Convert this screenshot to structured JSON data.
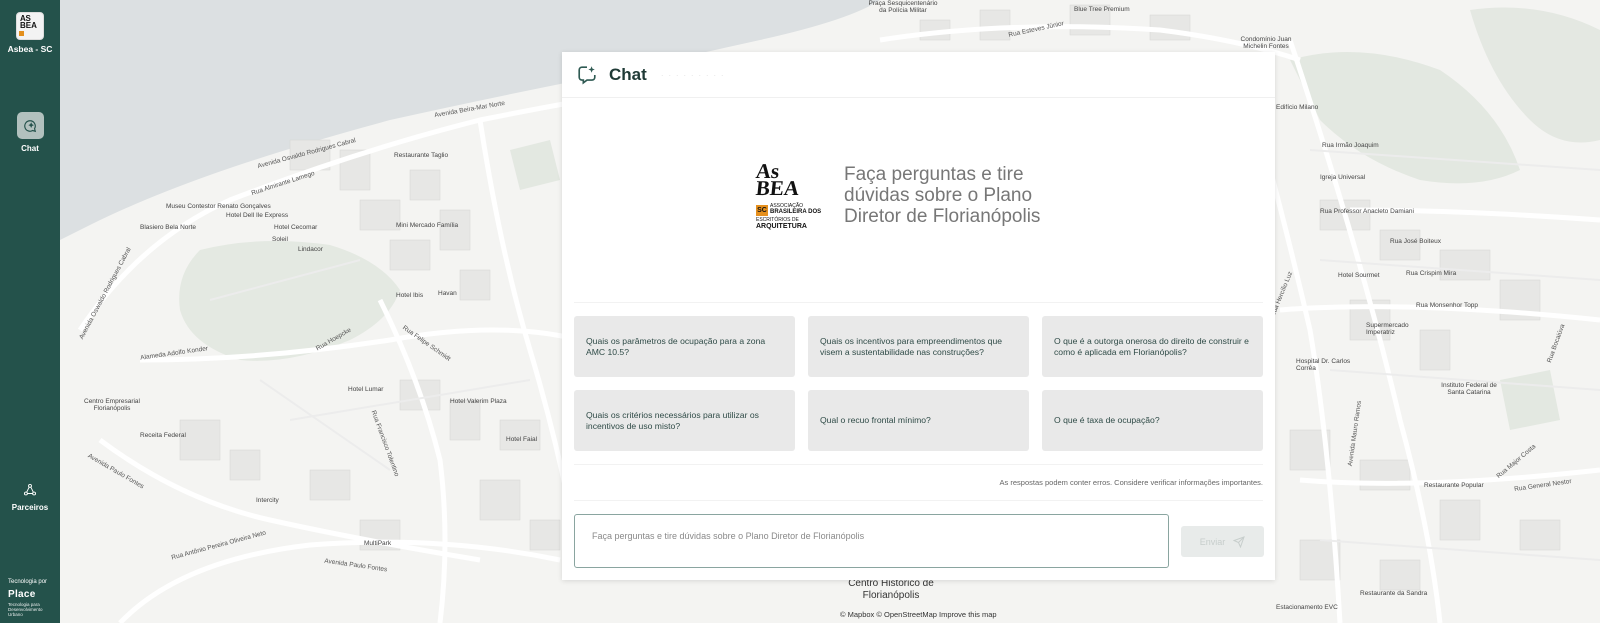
{
  "sidebar": {
    "org_name": "Asbea - SC",
    "logo_text_1": "AS",
    "logo_text_2": "BEA",
    "items": [
      {
        "label": "Chat",
        "icon": "chat-sparkle-icon"
      },
      {
        "label": "Parceiros",
        "icon": "partners-icon"
      }
    ],
    "footer": {
      "powered_by": "Tecnologia por",
      "brand": "Place",
      "tagline": "Tecnologia para Desenvolvimento Urbano"
    }
  },
  "chat": {
    "title": "Chat",
    "subtitle": "· · · · · · · · ·",
    "logo": {
      "line1": "As",
      "line2": "BEA",
      "badge": "SC",
      "text1": "ASSOCIAÇÃO",
      "text2": "BRASILEIRA DOS",
      "text3": "ESCRITÓRIOS DE",
      "text4": "ARQUITETURA"
    },
    "hero_text": "Faça perguntas e tire dúvidas sobre o Plano Diretor de Florianópolis",
    "questions": [
      "Quais os parâmetros de ocupação para a zona AMC 10.5?",
      "Quais os incentivos para empreendimentos que visem a sustentabilidade nas construções?",
      "O que é a outorga onerosa do direito de construir e como é aplicada em Florianópolis?",
      "Quais os critérios necessários para utilizar os incentivos de uso misto?",
      "Qual o recuo frontal mínimo?",
      "O que é taxa de ocupação?"
    ],
    "disclaimer": "As respostas podem conter erros. Considere verificar informações importantes.",
    "input_placeholder": "Faça perguntas e tire dúvidas sobre o Plano Diretor de Florianópolis",
    "send_label": "Enviar"
  },
  "map": {
    "attribution": "© Mapbox © OpenStreetMap Improve this map",
    "labels": [
      "Avenida Osvaldo Rodrigues Cabral",
      "Avenida Beira-Mar Norte",
      "Rua Almirante Lamego",
      "Museu Contestor Renato Gonçalves",
      "Hotel Dell Ile Express",
      "Blasiero Bela Norte",
      "Hotel Cecomar",
      "Soleil",
      "Restaurante Taglio",
      "Lindacor",
      "Mini Mercado Família",
      "Hotel Ibis",
      "Havan",
      "Avenida Oswaldo Rodrigues Cabral",
      "Alameda Adolfo Konder",
      "Rua Hoepcke",
      "Rua Felipe Schmidt",
      "Hotel Lumar",
      "Hotel Valerim Plaza",
      "Centro Empresarial Florianópolis",
      "Receita Federal",
      "Rua Francisco Tolentino",
      "Hotel Faial",
      "Intercity",
      "Avenida Paulo Fontes",
      "Rua Antônio Pereira Oliveira Neto",
      "Avenida Paulo Fontes",
      "MultiPark",
      "Centro Histórico de Florianópolis",
      "Avenida Hercílio Luz",
      "Rua Irmão Joaquim",
      "Igreja Universal",
      "Rua Professor Anacleto Damiani",
      "Rua José Boiteux",
      "Hotel Sourmet",
      "Rua Crispim Mira",
      "Rua Monsenhor Topp",
      "Supermercado Imperatriz",
      "Hospital Dr. Carlos Corrêa",
      "Instituto Federal de Santa Catarina",
      "Avenida Mauro Ramos",
      "Restaurante Popular",
      "Rua General Nestor",
      "Rua Major Costa",
      "Estacionamento EVC",
      "Restaurante da Sandra",
      "Rua Bocaiúva",
      "Edifício Milano",
      "Rua Esteves Júnior",
      "Praça Sesquicentenário da Polícia Militar",
      "Blue Tree Premium",
      "Condomínio Juan Michelin Fontes"
    ]
  }
}
